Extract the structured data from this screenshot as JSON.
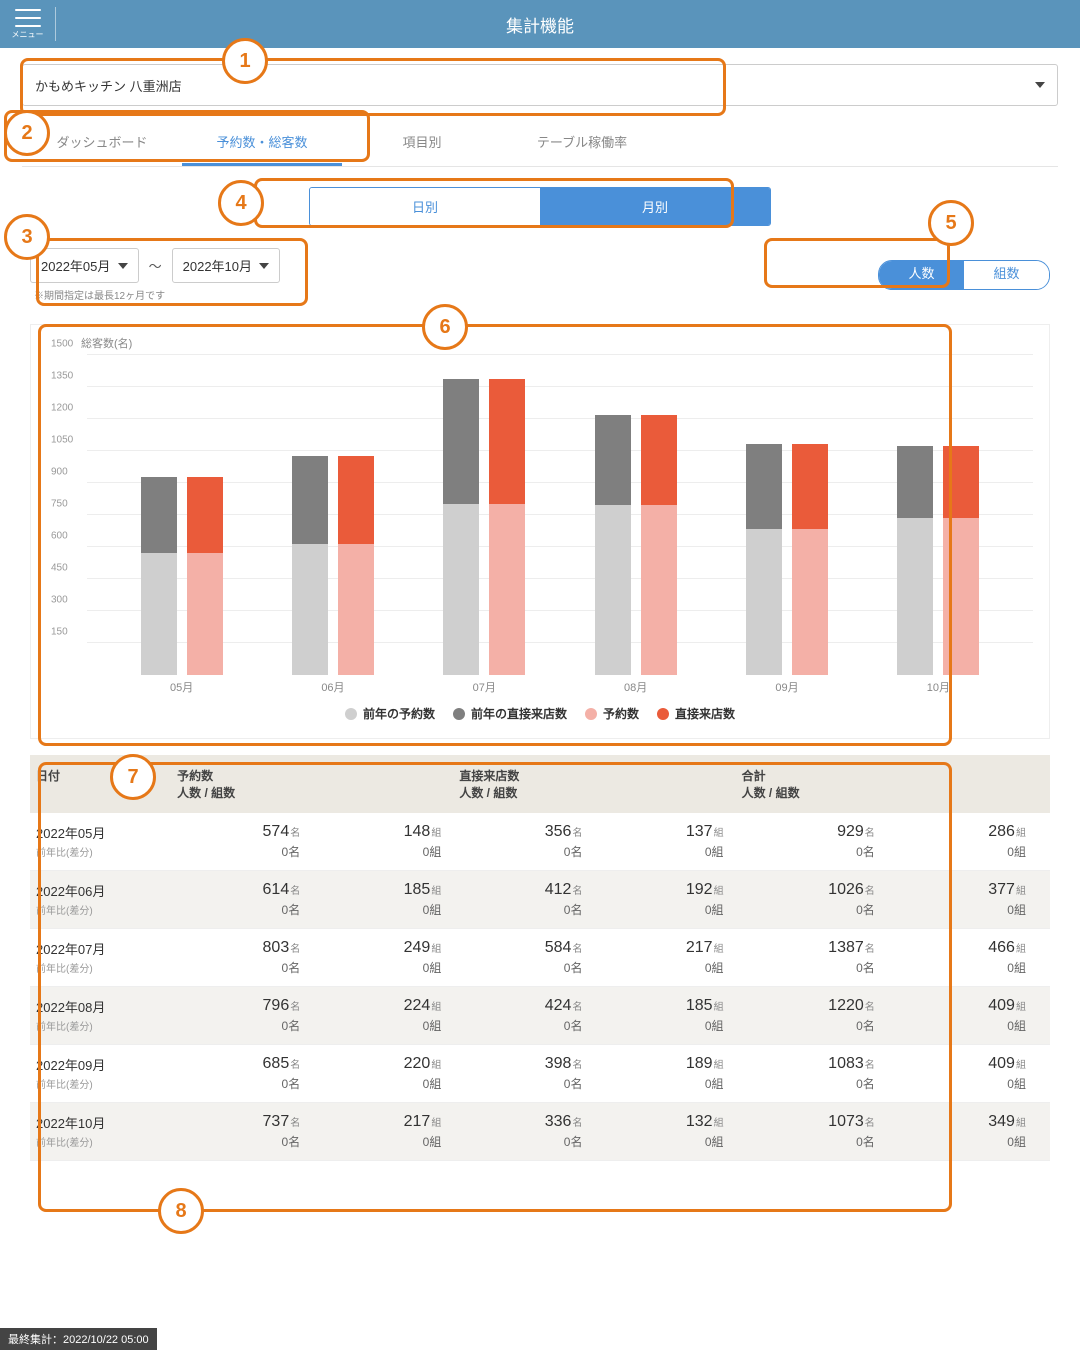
{
  "header": {
    "menu_label": "メニュー",
    "title": "集計機能"
  },
  "store_dropdown": {
    "value": "かもめキッチン 八重洲店"
  },
  "tabs": [
    "ダッシュボード",
    "予約数・総客数",
    "項目別",
    "テーブル稼働率"
  ],
  "active_tab": 1,
  "period_segment": {
    "daily": "日別",
    "monthly": "月別",
    "active": "monthly"
  },
  "range": {
    "from": "2022年05月",
    "to": "2022年10月",
    "sep": "～",
    "note": "※期間指定は最長12ヶ月です"
  },
  "metric_segment": {
    "people": "人数",
    "groups": "組数",
    "active": "people"
  },
  "callouts": [
    "1",
    "2",
    "3",
    "4",
    "5",
    "6",
    "7",
    "8"
  ],
  "chart_data": {
    "type": "bar",
    "title": "総客数(名)",
    "ylabel": "",
    "ylim": [
      0,
      1500
    ],
    "yticks": [
      150,
      300,
      450,
      600,
      750,
      900,
      1050,
      1200,
      1350,
      1500
    ],
    "categories": [
      "05月",
      "06月",
      "07月",
      "08月",
      "09月",
      "10月"
    ],
    "series": [
      {
        "name": "前年の予約数",
        "color": "#cfcfcf",
        "stack": "prev",
        "values": [
          574,
          614,
          803,
          796,
          685,
          737
        ]
      },
      {
        "name": "前年の直接来店数",
        "color": "#7f7f7f",
        "stack": "prev",
        "values": [
          356,
          412,
          584,
          424,
          398,
          336
        ]
      },
      {
        "name": "予約数",
        "color": "#f4b0a7",
        "stack": "cur",
        "values": [
          574,
          614,
          803,
          796,
          685,
          737
        ]
      },
      {
        "name": "直接来店数",
        "color": "#ea5b3a",
        "stack": "cur",
        "values": [
          356,
          412,
          584,
          424,
          398,
          336
        ]
      }
    ],
    "totals": [
      929,
      1026,
      1387,
      1220,
      1083,
      1073
    ]
  },
  "table": {
    "headers": {
      "date": "日付",
      "reserve": {
        "t": "予約数",
        "s": "人数 / 組数"
      },
      "walkin": {
        "t": "直接来店数",
        "s": "人数 / 組数"
      },
      "total": {
        "t": "合計",
        "s": "人数 / 組数"
      }
    },
    "suffix": {
      "ppl": "名",
      "grp": "組"
    },
    "sub_label": "前年比(差分)",
    "diff_ppl": "0名",
    "diff_grp": "0組",
    "rows": [
      {
        "month": "2022年05月",
        "r_ppl": 574,
        "r_grp": 148,
        "w_ppl": 356,
        "w_grp": 137,
        "t_ppl": 929,
        "t_grp": 286
      },
      {
        "month": "2022年06月",
        "r_ppl": 614,
        "r_grp": 185,
        "w_ppl": 412,
        "w_grp": 192,
        "t_ppl": 1026,
        "t_grp": 377
      },
      {
        "month": "2022年07月",
        "r_ppl": 803,
        "r_grp": 249,
        "w_ppl": 584,
        "w_grp": 217,
        "t_ppl": 1387,
        "t_grp": 466
      },
      {
        "month": "2022年08月",
        "r_ppl": 796,
        "r_grp": 224,
        "w_ppl": 424,
        "w_grp": 185,
        "t_ppl": 1220,
        "t_grp": 409
      },
      {
        "month": "2022年09月",
        "r_ppl": 685,
        "r_grp": 220,
        "w_ppl": 398,
        "w_grp": 189,
        "t_ppl": 1083,
        "t_grp": 409
      },
      {
        "month": "2022年10月",
        "r_ppl": 737,
        "r_grp": 217,
        "w_ppl": 336,
        "w_grp": 132,
        "t_ppl": 1073,
        "t_grp": 349
      }
    ]
  },
  "footer": "最終集計：2022/10/22 05:00"
}
